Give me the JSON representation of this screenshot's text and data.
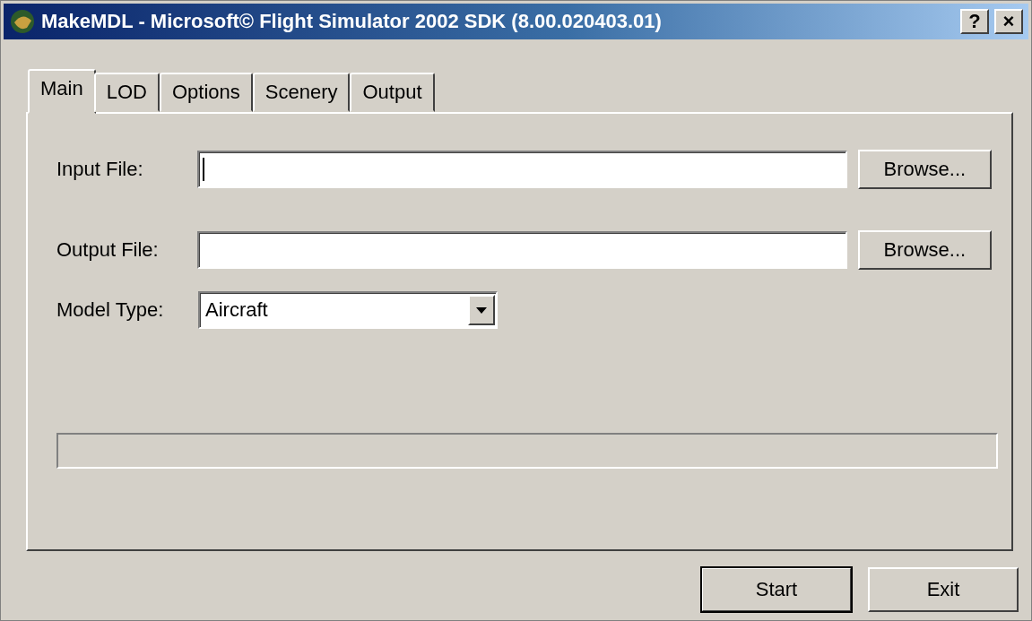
{
  "window": {
    "title": "MakeMDL - Microsoft© Flight Simulator 2002 SDK (8.00.020403.01)",
    "title_buttons": [
      "?",
      "×"
    ]
  },
  "tabs": [
    {
      "label": "Main",
      "selected": true
    },
    {
      "label": "LOD",
      "selected": false
    },
    {
      "label": "Options",
      "selected": false
    },
    {
      "label": "Scenery",
      "selected": false
    },
    {
      "label": "Output",
      "selected": false
    }
  ],
  "fields": [
    {
      "label": "Input File:",
      "focused": true,
      "button": "Browse..."
    },
    {
      "label": "Output File:",
      "focused": false,
      "button": "Browse..."
    }
  ],
  "model_type": {
    "label": "Model Type:",
    "value": "Aircraft"
  },
  "progress": {
    "level": 0
  },
  "buttons": [
    {
      "label": "Start",
      "default": true
    },
    {
      "label": "Exit",
      "default": false
    }
  ]
}
